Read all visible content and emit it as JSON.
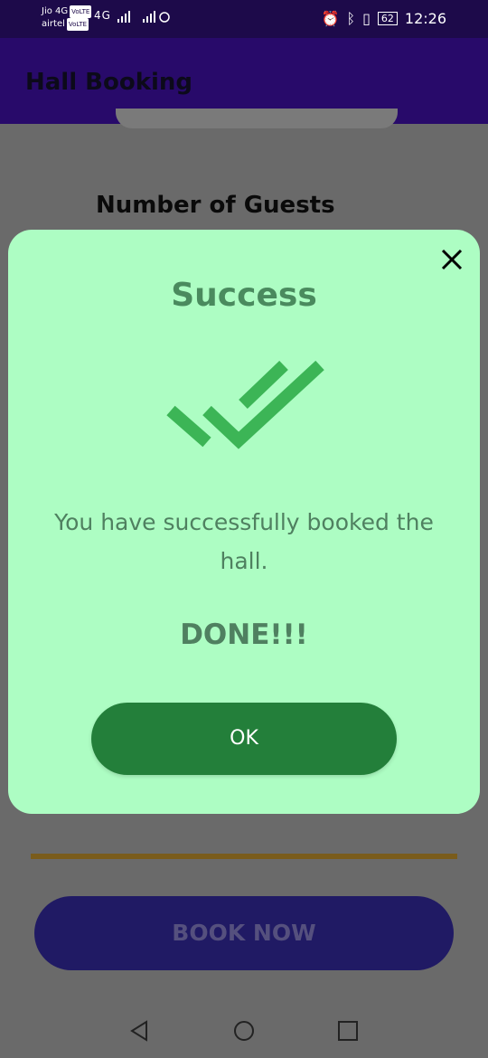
{
  "status_bar": {
    "carrier1": "Jio 4G",
    "carrier2": "airtel",
    "volte_tag": "VoLTE",
    "network": "4G",
    "battery": "62",
    "time": "12:26"
  },
  "app_bar": {
    "title": "Hall Booking"
  },
  "form": {
    "guests_label": "Number of Guests",
    "book_button": "BOOK NOW"
  },
  "dialog": {
    "title": "Success",
    "message": "You have successfully booked the hall.",
    "done_text": "DONE!!!",
    "ok_button": "OK",
    "icon": "double-check-icon"
  },
  "colors": {
    "app_bar": "#280a6a",
    "dialog_bg": "#adfdc3",
    "ok_button": "#237f3a",
    "check": "#3cb556",
    "book_button": "#201a64"
  }
}
